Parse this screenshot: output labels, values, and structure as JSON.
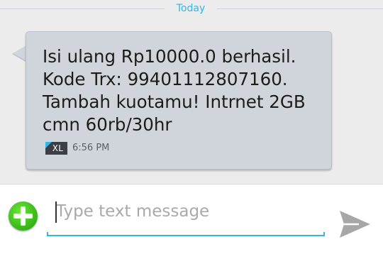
{
  "thread": {
    "date_label": "Today",
    "messages": [
      {
        "text": "Isi ulang Rp10000.0 berhasil. Kode Trx: 99401112807160. Tambah kuotamu! Intrnet 2GB cmn 60rb/30hr",
        "sim_label": "XL",
        "time": "6:56 PM"
      }
    ]
  },
  "compose": {
    "placeholder": "Type text message",
    "value": "",
    "attach_icon": "add-icon",
    "send_icon": "send-icon"
  },
  "colors": {
    "accent": "#33b5e5",
    "bubble": "#cfd5da",
    "background": "#ececec",
    "attach_green": "#3fbf1d",
    "send_gray": "#a7a7a7"
  }
}
